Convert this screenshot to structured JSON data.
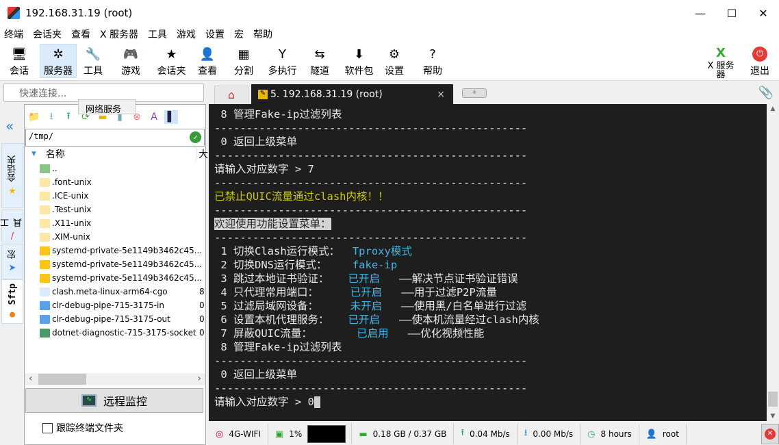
{
  "window": {
    "title": "192.168.31.19 (root)",
    "min": "—",
    "max": "☐",
    "close": "✕"
  },
  "menu": [
    "终端",
    "会话夹",
    "查看",
    "X 服务器",
    "工具",
    "游戏",
    "设置",
    "宏",
    "帮助"
  ],
  "toolbar": [
    {
      "label": "会话",
      "icon": "session-icon",
      "glyph": "🖥"
    },
    {
      "label": "服务器",
      "icon": "servers-icon",
      "glyph": "✲"
    },
    {
      "label": "工具",
      "icon": "tools-icon",
      "glyph": "🔧"
    },
    {
      "label": "游戏",
      "icon": "games-icon",
      "glyph": "🎮"
    },
    {
      "label": "会话夹",
      "icon": "star-icon",
      "glyph": "★"
    },
    {
      "label": "查看",
      "icon": "view-icon",
      "glyph": "👤"
    },
    {
      "label": "分割",
      "icon": "split-icon",
      "glyph": "▦"
    },
    {
      "label": "多执行",
      "icon": "multiexec-icon",
      "glyph": "Y"
    },
    {
      "label": "隧道",
      "icon": "tunnel-icon",
      "glyph": "⇆"
    },
    {
      "label": "软件包",
      "icon": "packages-icon",
      "glyph": "⬇"
    },
    {
      "label": "设置",
      "icon": "settings-icon",
      "glyph": "⚙"
    },
    {
      "label": "帮助",
      "icon": "help-icon",
      "glyph": "?"
    }
  ],
  "xserver": {
    "label": "X 服务器",
    "icon": "x-server-icon"
  },
  "exit": {
    "label": "退出",
    "icon": "power-icon"
  },
  "quick_connect": {
    "placeholder": "快速连接..."
  },
  "tooltip": "网络服务",
  "side_tabs": [
    "会话夹",
    "工具",
    "宏",
    "Sftp"
  ],
  "sftp": {
    "path": "/tmp/",
    "column_name": "名称",
    "column_size": "大",
    "files": [
      {
        "name": "..",
        "type": "parent",
        "size": ""
      },
      {
        "name": ".font-unix",
        "type": "folder-light",
        "size": ""
      },
      {
        "name": ".ICE-unix",
        "type": "folder-light",
        "size": ""
      },
      {
        "name": ".Test-unix",
        "type": "folder-light",
        "size": ""
      },
      {
        "name": ".X11-unix",
        "type": "folder-light",
        "size": ""
      },
      {
        "name": ".XIM-unix",
        "type": "folder-light",
        "size": ""
      },
      {
        "name": "systemd-private-5e1149b3462c45...",
        "type": "folder",
        "size": ""
      },
      {
        "name": "systemd-private-5e1149b3462c45...",
        "type": "folder",
        "size": ""
      },
      {
        "name": "systemd-private-5e1149b3462c45...",
        "type": "folder",
        "size": ""
      },
      {
        "name": "clash.meta-linux-arm64-cgo",
        "type": "file",
        "size": "8"
      },
      {
        "name": "clr-debug-pipe-715-3175-in",
        "type": "pipe",
        "size": "0"
      },
      {
        "name": "clr-debug-pipe-715-3175-out",
        "type": "pipe",
        "size": "0"
      },
      {
        "name": "dotnet-diagnostic-715-3175-socket",
        "type": "socket",
        "size": "0"
      }
    ],
    "monitor_label": "远程监控",
    "follow_label": "跟踪终端文件夹",
    "follow_checked": false
  },
  "session_tab": {
    "label": "5. 192.168.31.19 (root)",
    "close": "×"
  },
  "terminal": [
    [
      [
        " 8 管理Fake-ip过滤列表",
        ""
      ]
    ],
    [
      [
        "-------------------------------------------------",
        ""
      ]
    ],
    [
      [
        " 0 返回上级菜单",
        ""
      ]
    ],
    [
      [
        "-------------------------------------------------",
        ""
      ]
    ],
    [
      [
        "请输入对应数字 > 7",
        ""
      ]
    ],
    [
      [
        "-------------------------------------------------",
        ""
      ]
    ],
    [
      [
        "已禁止QUIC流量通过clash内核！！",
        "yellow"
      ]
    ],
    [
      [
        "-------------------------------------------------",
        ""
      ]
    ],
    [
      [
        "欢迎使用功能设置菜单：",
        "hl"
      ]
    ],
    [
      [
        "-------------------------------------------------",
        ""
      ]
    ],
    [
      [
        " 1 切换Clash运行模式：  ",
        ""
      ],
      [
        "Tproxy模式",
        "cyan"
      ]
    ],
    [
      [
        " 2 切换DNS运行模式：    ",
        ""
      ],
      [
        "fake-ip",
        "cyan"
      ]
    ],
    [
      [
        " 3 跳过本地证书验证：   ",
        ""
      ],
      [
        "已开启",
        "cyan"
      ],
      [
        "   ——解决节点证书验证错误",
        ""
      ]
    ],
    [
      [
        " 4 只代理常用端口：     ",
        ""
      ],
      [
        "已开启",
        "cyan"
      ],
      [
        "   ——用于过滤P2P流量",
        ""
      ]
    ],
    [
      [
        " 5 过滤局域网设备：     ",
        ""
      ],
      [
        "未开启",
        "cyan"
      ],
      [
        "   ——使用黑/白名单进行过滤",
        ""
      ]
    ],
    [
      [
        " 6 设置本机代理服务：   ",
        ""
      ],
      [
        "已开启",
        "cyan"
      ],
      [
        "   ——使本机流量经过clash内核",
        ""
      ]
    ],
    [
      [
        " 7 屏蔽QUIC流量：       ",
        ""
      ],
      [
        "已启用",
        "cyan"
      ],
      [
        "   ——优化视频性能",
        ""
      ]
    ],
    [
      [
        " 8 管理Fake-ip过滤列表",
        ""
      ]
    ],
    [
      [
        "-------------------------------------------------",
        ""
      ]
    ],
    [
      [
        " 0 返回上级菜单",
        ""
      ]
    ],
    [
      [
        "-------------------------------------------------",
        ""
      ]
    ],
    [
      [
        "请输入对应数字 > 0",
        ""
      ]
    ]
  ],
  "status": {
    "network": "4G-WIFI",
    "cpu": "1%",
    "memory": "0.18 GB / 0.37 GB",
    "upload": "0.04 Mb/s",
    "download": "0.00 Mb/s",
    "uptime": "8 hours",
    "user": "root"
  }
}
